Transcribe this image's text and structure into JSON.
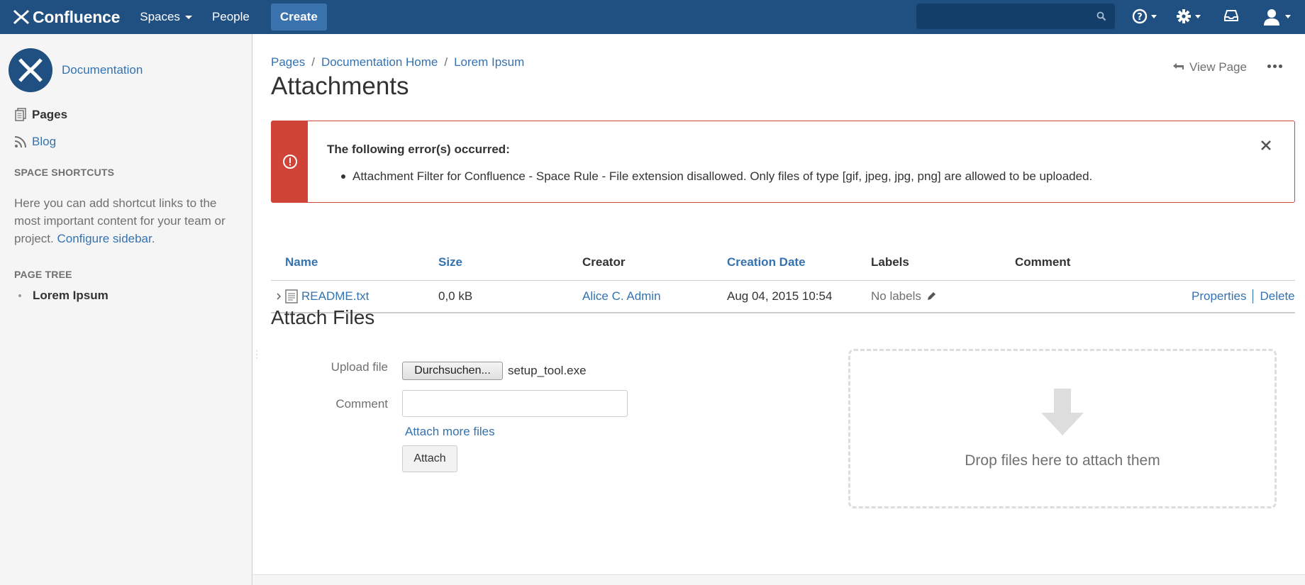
{
  "topnav": {
    "logo_text": "Confluence",
    "spaces_label": "Spaces",
    "people_label": "People",
    "create_label": "Create",
    "search_placeholder": "",
    "brand_color": "#205081"
  },
  "sidebar": {
    "space_name": "Documentation",
    "pages_label": "Pages",
    "blog_label": "Blog",
    "shortcuts_heading": "SPACE SHORTCUTS",
    "shortcuts_text": "Here you can add shortcut links to the most important content for your team or project.",
    "configure_link": "Configure sidebar",
    "period": ".",
    "page_tree_heading": "PAGE TREE",
    "tree_items": [
      {
        "label": "Lorem Ipsum"
      }
    ]
  },
  "breadcrumb": [
    "Pages",
    "Documentation Home",
    "Lorem Ipsum"
  ],
  "breadcrumb_sep": "/",
  "page": {
    "title": "Attachments",
    "view_page_label": "View Page"
  },
  "error": {
    "title": "The following error(s) occurred:",
    "messages": [
      "Attachment Filter for Confluence - Space Rule - File extension disallowed. Only files of type [gif, jpeg, jpg, png] are allowed to be uploaded."
    ],
    "color": "#d04437"
  },
  "table": {
    "columns": [
      "Name",
      "Size",
      "Creator",
      "Creation Date",
      "Labels",
      "Comment"
    ],
    "rows": [
      {
        "name": "README.txt",
        "size": "0,0 kB",
        "creator": "Alice C. Admin",
        "date": "Aug 04, 2015 10:54",
        "labels": "No labels",
        "comment": "",
        "actions": [
          "Properties",
          "Delete"
        ]
      }
    ]
  },
  "attach": {
    "section_title": "Attach Files",
    "upload_label": "Upload file",
    "browse_label": "Durchsuchen...",
    "selected_file": "setup_tool.exe",
    "comment_label": "Comment",
    "comment_value": "",
    "attach_more_label": "Attach more files",
    "attach_button_label": "Attach",
    "drop_text": "Drop files here to attach them"
  }
}
